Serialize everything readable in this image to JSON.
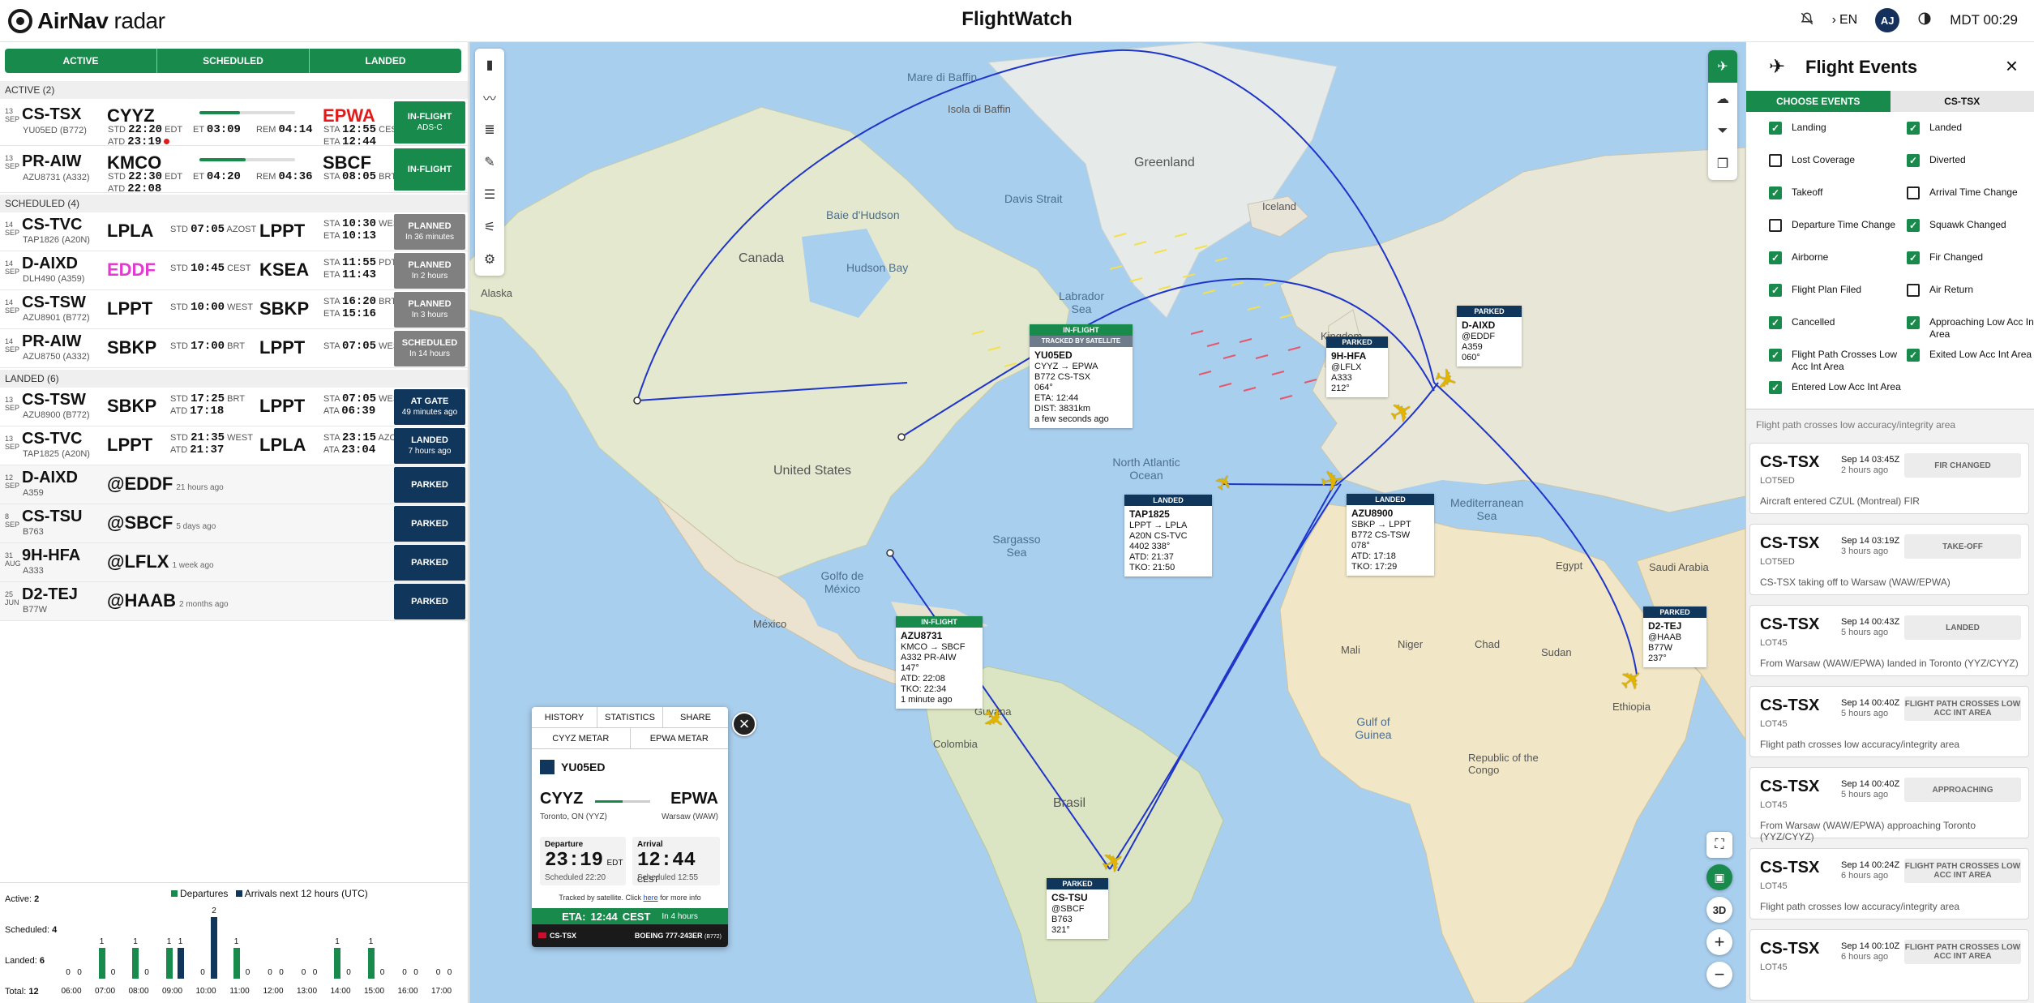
{
  "header": {
    "logo_bold": "AirNav",
    "logo_light": "radar",
    "title": "FlightWatch",
    "lang": "EN",
    "avatar": "AJ",
    "clock": "MDT 00:29"
  },
  "left": {
    "tabs": [
      "ACTIVE",
      "SCHEDULED",
      "LANDED"
    ],
    "sections": {
      "active": "ACTIVE (2)",
      "scheduled": "SCHEDULED (4)",
      "landed": "LANDED (6)"
    },
    "active": [
      {
        "day": "13",
        "mon": "SEP",
        "reg": "CS-TSX",
        "sub": "YU05ED (B772)",
        "orig": "CYYZ",
        "dep1": "STD",
        "dep1v": "22:20",
        "dep1z": "EDT",
        "dep2": "ATD",
        "dep2v": "23:19",
        "et": "03:09",
        "rem": "04:14",
        "dest": "EPWA",
        "arr1": "STA",
        "arr1v": "12:55",
        "arr1z": "CEST",
        "arr2": "ETA",
        "arr2v": "12:44",
        "status": "IN-FLIGHT",
        "status2": "ADS-C",
        "progress": 0.42
      },
      {
        "day": "13",
        "mon": "SEP",
        "reg": "PR-AIW",
        "sub": "AZU8731 (A332)",
        "orig": "KMCO",
        "dep1": "STD",
        "dep1v": "22:30",
        "dep1z": "EDT",
        "dep2": "ATD",
        "dep2v": "22:08",
        "et": "04:20",
        "rem": "04:36",
        "dest": "SBCF",
        "arr1": "STA",
        "arr1v": "08:05",
        "arr1z": "BRT",
        "arr2": "",
        "arr2v": "",
        "status": "IN-FLIGHT",
        "status2": "",
        "progress": 0.48
      }
    ],
    "scheduled": [
      {
        "day": "14",
        "mon": "SEP",
        "reg": "CS-TVC",
        "sub": "TAP1826 (A20N)",
        "orig": "LPLA",
        "std": "07:05",
        "stdz": "AZOST",
        "dest": "LPPT",
        "a1": "STA",
        "a1v": "10:30",
        "a1z": "WEST",
        "a2": "ETA",
        "a2v": "10:13",
        "status": "PLANNED",
        "status2": "In 36 minutes"
      },
      {
        "day": "14",
        "mon": "SEP",
        "reg": "D-AIXD",
        "sub": "DLH490 (A359)",
        "orig": "EDDF",
        "std": "10:45",
        "stdz": "CEST",
        "dest": "KSEA",
        "a1": "STA",
        "a1v": "11:55",
        "a1z": "PDT",
        "a2": "ETA",
        "a2v": "11:43",
        "status": "PLANNED",
        "status2": "In 2 hours"
      },
      {
        "day": "14",
        "mon": "SEP",
        "reg": "CS-TSW",
        "sub": "AZU8901 (B772)",
        "orig": "LPPT",
        "std": "10:00",
        "stdz": "WEST",
        "dest": "SBKP",
        "a1": "STA",
        "a1v": "16:20",
        "a1z": "BRT",
        "a2": "ETA",
        "a2v": "15:16",
        "status": "PLANNED",
        "status2": "In 3 hours"
      },
      {
        "day": "14",
        "mon": "SEP",
        "reg": "PR-AIW",
        "sub": "AZU8750 (A332)",
        "orig": "SBKP",
        "std": "17:00",
        "stdz": "BRT",
        "dest": "LPPT",
        "a1": "STA",
        "a1v": "07:05",
        "a1z": "WEST",
        "a2": "",
        "a2v": "",
        "status": "SCHEDULED",
        "status2": "In 14 hours"
      }
    ],
    "landed": [
      {
        "day": "13",
        "mon": "SEP",
        "reg": "CS-TSW",
        "sub": "AZU8900 (B772)",
        "orig": "SBKP",
        "std": "17:25",
        "stdz": "BRT",
        "atd": "17:18",
        "dest": "LPPT",
        "a1v": "07:05",
        "a1z": "WEST",
        "a2v": "06:39",
        "status": "AT GATE",
        "status2": "49 minutes ago"
      },
      {
        "day": "13",
        "mon": "SEP",
        "reg": "CS-TVC",
        "sub": "TAP1825 (A20N)",
        "orig": "LPPT",
        "std": "21:35",
        "stdz": "WEST",
        "atd": "21:37",
        "dest": "LPLA",
        "a1v": "23:15",
        "a1z": "AZOST",
        "a2v": "23:04",
        "status": "LANDED",
        "status2": "7 hours ago"
      }
    ],
    "parked": [
      {
        "day": "12",
        "mon": "SEP",
        "reg": "D-AIXD",
        "sub": "A359",
        "loc": "@EDDF",
        "ago": "21 hours ago",
        "status": "PARKED"
      },
      {
        "day": "8",
        "mon": "SEP",
        "reg": "CS-TSU",
        "sub": "B763",
        "loc": "@SBCF",
        "ago": "5 days ago",
        "status": "PARKED"
      },
      {
        "day": "31",
        "mon": "AUG",
        "reg": "9H-HFA",
        "sub": "A333",
        "loc": "@LFLX",
        "ago": "1 week ago",
        "status": "PARKED"
      },
      {
        "day": "25",
        "mon": "JUN",
        "reg": "D2-TEJ",
        "sub": "B77W",
        "loc": "@HAAB",
        "ago": "2 months ago",
        "status": "PARKED"
      }
    ],
    "histogram": {
      "legend_dep": "Departures",
      "legend_arr": "Arrivals next 12 hours (UTC)",
      "stats": [
        {
          "label": "Active:",
          "value": "2"
        },
        {
          "label": "Scheduled:",
          "value": "4"
        },
        {
          "label": "Landed:",
          "value": "6"
        },
        {
          "label": "Total:",
          "value": "12"
        }
      ]
    }
  },
  "chart_data": {
    "type": "bar",
    "categories": [
      "06:00",
      "07:00",
      "08:00",
      "09:00",
      "10:00",
      "11:00",
      "12:00",
      "13:00",
      "14:00",
      "15:00",
      "16:00",
      "17:00"
    ],
    "series": [
      {
        "name": "Departures",
        "values": [
          0,
          1,
          1,
          1,
          0,
          1,
          0,
          0,
          1,
          1,
          0,
          0
        ]
      },
      {
        "name": "Arrivals next 12 hours (UTC)",
        "values": [
          0,
          0,
          0,
          1,
          2,
          0,
          0,
          0,
          0,
          0,
          0,
          0
        ]
      }
    ],
    "title": "",
    "ylim": [
      0,
      2
    ],
    "colors": {
      "dep": "#178a4c",
      "arr": "#10365b"
    }
  },
  "map": {
    "labels": {
      "greenland": "Greenland",
      "iceland": "Iceland",
      "canada": "Canada",
      "us": "United States",
      "alaska": "Alaska",
      "baffin": "Mare di Baffin",
      "baffinis": "Isola di Baffin",
      "hudson": "Baie d'Hudson",
      "hudsonbay": "Hudson Bay",
      "davis": "Davis Strait",
      "labrador": "Labrador Sea",
      "natl": "North Atlantic Ocean",
      "sargasso": "Sargasso Sea",
      "golfo": "Golfo de México",
      "mexico": "México",
      "colombia": "Colombia",
      "guyana": "Guyana",
      "brasil": "Brasil",
      "kingdom": "Kingdom",
      "med": "Mediterranean Sea",
      "egypt": "Egypt",
      "saudi": "Saudi Arabia",
      "mali": "Mali",
      "niger": "Niger",
      "chad": "Chad",
      "sudan": "Sudan",
      "ethiopia": "Ethiopia",
      "guinea": "Gulf of Guinea",
      "congo": "Republic of the Congo"
    },
    "tags": {
      "yu05ed": {
        "h1": "IN-FLIGHT",
        "h2": "TRACKED BY SATELLITE",
        "id": "YU05ED",
        "l1": "CYYZ → EPWA",
        "l2": "B772   CS-TSX",
        "l3": "064°",
        "l4": "ETA: 12:44",
        "l5": "DIST: 3831km",
        "l6": "a few seconds ago"
      },
      "azu8731": {
        "h1": "IN-FLIGHT",
        "id": "AZU8731",
        "l1": "KMCO → SBCF",
        "l2": "A332   PR-AIW",
        "l3": "147°",
        "l4": "ATD: 22:08",
        "l5": "TKO: 22:34",
        "l6": "1 minute ago"
      },
      "tap1825": {
        "h1": "LANDED",
        "id": "TAP1825",
        "l1": "LPPT → LPLA",
        "l2": "A20N   CS-TVC",
        "l3": "4402   338°",
        "l4": "ATD: 21:37",
        "l5": "TKO: 21:50"
      },
      "azu8900": {
        "h1": "LANDED",
        "id": "AZU8900",
        "l1": "SBKP → LPPT",
        "l2": "B772   CS-TSW",
        "l3": "078°",
        "l4": "ATD: 17:18",
        "l5": "TKO: 17:29"
      },
      "hfa": {
        "h1": "PARKED",
        "id": "9H-HFA",
        "l1": "@LFLX",
        "l2": "A333",
        "l3": "212°"
      },
      "aixd": {
        "h1": "PARKED",
        "id": "D-AIXD",
        "l1": "@EDDF",
        "l2": "A359",
        "l3": "060°"
      },
      "tej": {
        "h1": "PARKED",
        "id": "D2-TEJ",
        "l1": "@HAAB",
        "l2": "B77W",
        "l3": "237°"
      },
      "tsu": {
        "h1": "PARKED",
        "id": "CS-TSU",
        "l1": "@SBCF",
        "l2": "B763",
        "l3": "321°"
      }
    },
    "card": {
      "tabs1": [
        "HISTORY",
        "STATISTICS",
        "SHARE"
      ],
      "tabs2": [
        "CYYZ METAR",
        "EPWA METAR"
      ],
      "callsign": "YU05ED",
      "orig": "CYYZ",
      "orig_city": "Toronto, ON (YYZ)",
      "dest": "EPWA",
      "dest_city": "Warsaw (WAW)",
      "dep_label": "Departure",
      "dep_time": "23:19",
      "dep_zone": "EDT",
      "dep_sched": "Scheduled 22:20",
      "arr_label": "Arrival",
      "arr_time": "12:44",
      "arr_zone": "CEST",
      "arr_sched": "Scheduled 12:55",
      "note_pre": "Tracked by satellite. Click",
      "note_link": "here",
      "note_post": "for more info",
      "eta_label": "ETA:",
      "eta_time": "12:44",
      "eta_zone": "CEST",
      "eta_in": "In 4 hours",
      "reg": "CS-TSX",
      "type": "BOEING 777-243ER",
      "type_code": "(B772)"
    },
    "view_3d": "3D"
  },
  "events": {
    "title": "Flight Events",
    "tab_on": "CHOOSE EVENTS",
    "tab_off": "CS-TSX",
    "options": [
      {
        "label": "Landing",
        "checked": true
      },
      {
        "label": "Landed",
        "checked": true
      },
      {
        "label": "Lost Coverage",
        "checked": false
      },
      {
        "label": "Diverted",
        "checked": true
      },
      {
        "label": "Takeoff",
        "checked": true
      },
      {
        "label": "Arrival Time Change",
        "checked": false
      },
      {
        "label": "Departure Time Change",
        "checked": false
      },
      {
        "label": "Squawk Changed",
        "checked": true
      },
      {
        "label": "Airborne",
        "checked": true
      },
      {
        "label": "Fir Changed",
        "checked": true
      },
      {
        "label": "Flight Plan Filed",
        "checked": true
      },
      {
        "label": "Air Return",
        "checked": false
      },
      {
        "label": "Cancelled",
        "checked": true
      },
      {
        "label": "Approaching Low Acc Int Area",
        "checked": true
      },
      {
        "label": "Flight Path Crosses Low Acc Int Area",
        "checked": true
      },
      {
        "label": "Exited Low Acc Int Area",
        "checked": true
      },
      {
        "label": "Entered Low Acc Int Area",
        "checked": true
      }
    ],
    "partial": "Flight path crosses low accuracy/integrity area",
    "list": [
      {
        "reg": "CS-TSX",
        "call": "LOT5ED",
        "date": "Sep 14 03:45Z",
        "ago": "2 hours ago",
        "tag": "FIR CHANGED",
        "desc": "Aircraft entered CZUL (Montreal) FIR"
      },
      {
        "reg": "CS-TSX",
        "call": "LOT5ED",
        "date": "Sep 14 03:19Z",
        "ago": "3 hours ago",
        "tag": "TAKE-OFF",
        "desc": "CS-TSX taking off to Warsaw (WAW/EPWA)"
      },
      {
        "reg": "CS-TSX",
        "call": "LOT45",
        "date": "Sep 14 00:43Z",
        "ago": "5 hours ago",
        "tag": "LANDED",
        "desc": "From Warsaw (WAW/EPWA) landed in Toronto (YYZ/CYYZ)"
      },
      {
        "reg": "CS-TSX",
        "call": "LOT45",
        "date": "Sep 14 00:40Z",
        "ago": "5 hours ago",
        "tag": "FLIGHT PATH CROSSES LOW ACC INT AREA",
        "desc": "Flight path crosses low accuracy/integrity area"
      },
      {
        "reg": "CS-TSX",
        "call": "LOT45",
        "date": "Sep 14 00:40Z",
        "ago": "5 hours ago",
        "tag": "APPROACHING",
        "desc": "From Warsaw (WAW/EPWA) approaching Toronto (YYZ/CYYZ)"
      },
      {
        "reg": "CS-TSX",
        "call": "LOT45",
        "date": "Sep 14 00:24Z",
        "ago": "6 hours ago",
        "tag": "FLIGHT PATH CROSSES LOW ACC INT AREA",
        "desc": "Flight path crosses low accuracy/integrity area"
      },
      {
        "reg": "CS-TSX",
        "call": "LOT45",
        "date": "Sep 14 00:10Z",
        "ago": "6 hours ago",
        "tag": "FLIGHT PATH CROSSES LOW ACC INT AREA",
        "desc": ""
      }
    ]
  }
}
